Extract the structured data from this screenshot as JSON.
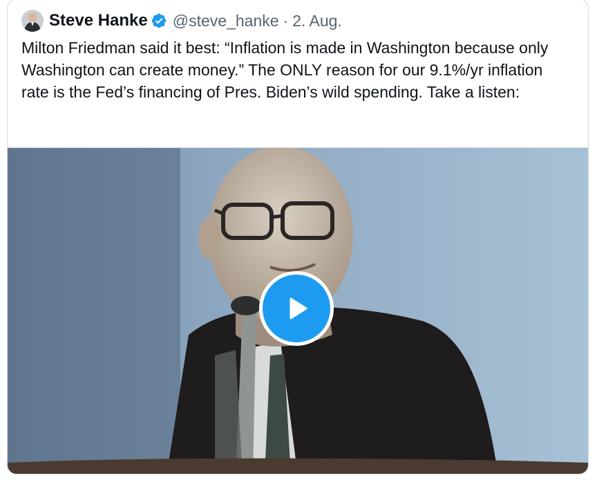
{
  "tweet": {
    "author_name": "Steve Hanke",
    "handle": "@steve_hanke",
    "separator": "·",
    "date": "2. Aug.",
    "text": "Milton Friedman said it best: “Inflation is made in Washington because only Washington can create money.” The ONLY reason for our 9.1%/yr inflation rate is the Fed’s financing of Pres. Biden’s wild spending. Take a listen:",
    "verified_badge_icon": "verified-badge-icon"
  },
  "media": {
    "type": "video",
    "play_icon": "play-icon"
  },
  "colors": {
    "accent": "#1d9bf0",
    "text_primary": "#0f1419",
    "text_secondary": "#536471",
    "border": "#cfd9de"
  }
}
